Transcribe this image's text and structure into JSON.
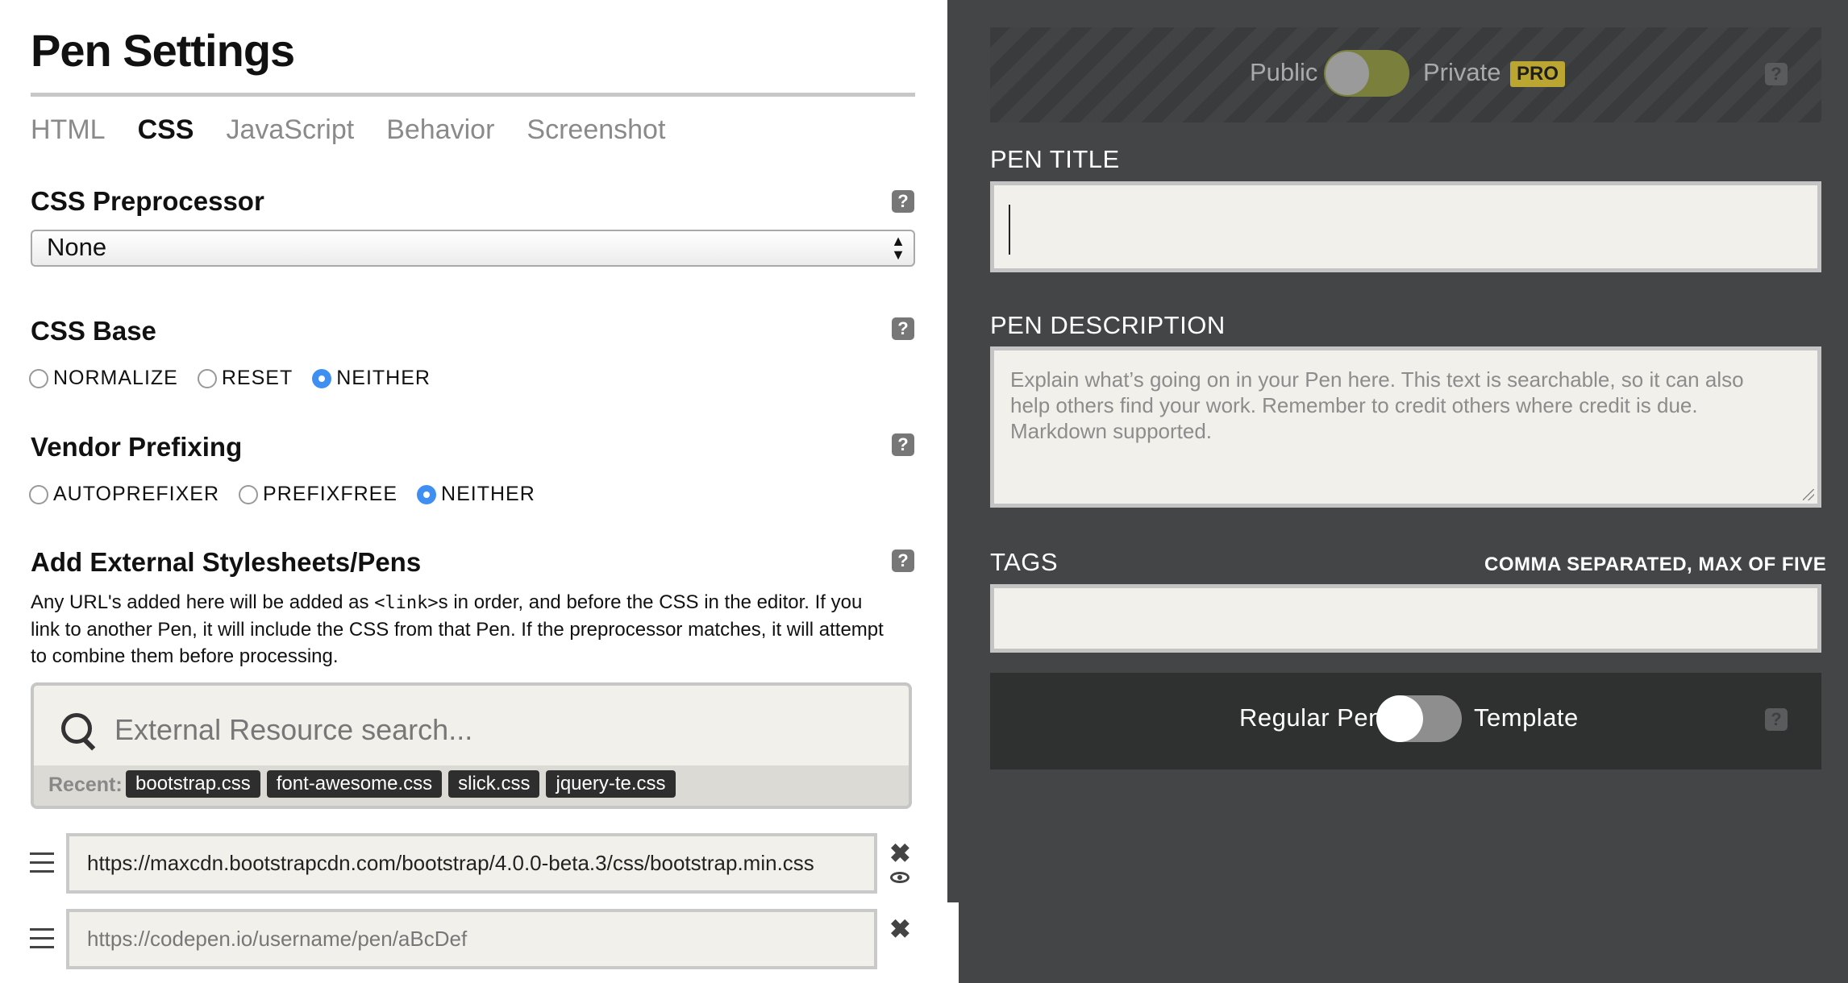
{
  "settings": {
    "title": "Pen Settings",
    "tabs": [
      {
        "label": "HTML"
      },
      {
        "label": "CSS",
        "active": true
      },
      {
        "label": "JavaScript"
      },
      {
        "label": "Behavior"
      },
      {
        "label": "Screenshot"
      }
    ],
    "help_glyph": "?",
    "preprocessor": {
      "heading": "CSS Preprocessor",
      "selected": "None"
    },
    "base": {
      "heading": "CSS Base",
      "options": [
        "NORMALIZE",
        "RESET",
        "NEITHER"
      ],
      "selected": "NEITHER"
    },
    "prefixing": {
      "heading": "Vendor Prefixing",
      "options": [
        "AUTOPREFIXER",
        "PREFIXFREE",
        "NEITHER"
      ],
      "selected": "NEITHER"
    },
    "external": {
      "heading": "Add External Stylesheets/Pens",
      "desc_before": "Any URL's added here will be added as ",
      "desc_code": "<link>",
      "desc_after": "s in order, and before the CSS in the editor. If you link to another Pen, it will include the CSS from that Pen. If the preprocessor matches, it will attempt to combine them before processing.",
      "search_placeholder": "External Resource search...",
      "recent_label": "Recent:",
      "recent": [
        "bootstrap.css",
        "font-awesome.css",
        "slick.css",
        "jquery-te.css"
      ],
      "resources": [
        {
          "value": "https://maxcdn.bootstrapcdn.com/bootstrap/4.0.0-beta.3/css/bootstrap.min.css",
          "placeholder": false
        },
        {
          "value": "https://codepen.io/username/pen/aBcDef",
          "placeholder": true
        }
      ],
      "remove_glyph": "✖"
    }
  },
  "details": {
    "privacy": {
      "public_label": "Public",
      "private_label": "Private",
      "pro_badge": "PRO",
      "is_private": false
    },
    "title_label": "PEN TITLE",
    "title_value": "",
    "description_label": "PEN DESCRIPTION",
    "description_placeholder": "Explain what’s going on in your Pen here. This text is searchable, so it can also help others find your work. Remember to credit others where credit is due. Markdown supported.",
    "tags_label": "TAGS",
    "tags_hint": "COMMA SEPARATED, MAX OF FIVE",
    "tags_value": "",
    "template": {
      "regular_label": "Regular Pen",
      "template_label": "Template",
      "is_template": false
    }
  },
  "colors": {
    "accent_blue": "#3f8ff3",
    "pro_gold": "#bba632",
    "dark_panel": "#444546"
  },
  "icons": [
    "help-icon",
    "search-icon",
    "drag-handle-icon",
    "close-icon",
    "eye-icon",
    "select-arrows-icon",
    "textarea-resize-icon"
  ]
}
